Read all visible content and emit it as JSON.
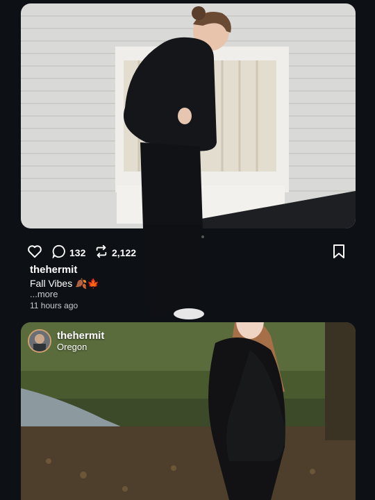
{
  "post1": {
    "actions": {
      "comment_count": "132",
      "repost_count": "2,122"
    },
    "username": "thehermit",
    "caption": "Fall Vibes 🍂🍁",
    "more": "...more",
    "time": "11 hours ago"
  },
  "post2": {
    "username": "thehermit",
    "location": "Oregon"
  },
  "icons": {
    "like": "heart-icon",
    "comment": "comment-icon",
    "repost": "repost-icon",
    "share": "share-icon",
    "bookmark": "bookmark-icon"
  },
  "colors": {
    "background": "#0d1015",
    "text": "#ffffff",
    "secondary_text": "#c8ccd2"
  }
}
